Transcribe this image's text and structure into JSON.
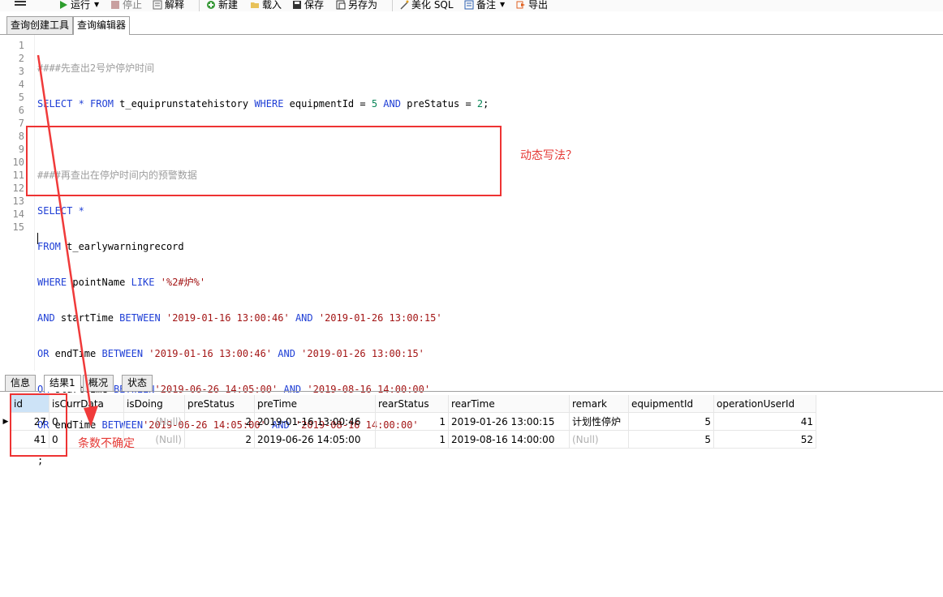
{
  "toolbar": {
    "run": "运行",
    "stop": "停止",
    "explain": "解释",
    "new": "新建",
    "load": "载入",
    "save": "保存",
    "save_as": "另存为",
    "beautify": "美化 SQL",
    "backup": "备注",
    "export": "导出"
  },
  "top_tabs": [
    "查询创建工具",
    "查询编辑器"
  ],
  "editor": {
    "line_numbers": [
      "1",
      "2",
      "3",
      "4",
      "5",
      "6",
      "7",
      "8",
      "9",
      "10",
      "11",
      "12",
      "13",
      "14",
      "15"
    ],
    "line1": "####先查出2号炉停炉时间",
    "line2_a": "SELECT * ",
    "line2_b": "FROM",
    "line2_c": " t_equiprunstatehistory ",
    "line2_d": "WHERE",
    "line2_e": " equipmentId = ",
    "line2_f": "5",
    "line2_g": "AND",
    "line2_h": " preStatus = ",
    "line2_i": "2",
    "line2_j": ";",
    "line4": "####再查出在停炉时间内的预警数据",
    "line5": "SELECT *",
    "line6_a": "FROM",
    "line6_b": " t_earlywarningrecord",
    "line7_a": "WHERE",
    "line7_b": " pointName ",
    "line7_c": "LIKE",
    "line7_d": "'%2#炉%'",
    "line8_a": "AND",
    "line8_b": " startTime ",
    "line8_c": "BETWEEN",
    "line8_d": "'2019-01-16 13:00:46'",
    "line8_e": "AND",
    "line8_f": "'2019-01-26 13:00:15'",
    "line9_a": "OR",
    "line9_b": " endTime ",
    "line9_c": "BETWEEN",
    "line9_d": "'2019-01-16 13:00:46'",
    "line9_e": "AND",
    "line9_f": "'2019-01-26 13:00:15'",
    "line10_a": "OR",
    "line10_b": " startTime ",
    "line10_c": "BETWEEN",
    "line10_d": "'2019-06-26 14:05:00'",
    "line10_e": "AND",
    "line10_f": "'2019-08-16 14:00:00'",
    "line11_a": "OR",
    "line11_b": " endTime ",
    "line11_c": "BETWEEN",
    "line11_d": "'2019-06-26 14:05:00'",
    "line11_e": "AND",
    "line11_f": "'2019-08-16 14:00:00'",
    "line12": ";"
  },
  "annotations": {
    "dynamic": "动态写法？",
    "count": "条数不确定"
  },
  "bottom_tabs": [
    "信息",
    "结果1",
    "概况",
    "状态"
  ],
  "result": {
    "columns": [
      "id",
      "isCurrData",
      "isDoing",
      "preStatus",
      "preTime",
      "rearStatus",
      "rearTime",
      "remark",
      "equipmentId",
      "operationUserId"
    ],
    "rows": [
      [
        "27",
        "0",
        "(Null)",
        "2",
        "2019-01-16 13:00:46",
        "1",
        "2019-01-26 13:00:15",
        "计划性停炉",
        "5",
        "41"
      ],
      [
        "41",
        "0",
        "(Null)",
        "2",
        "2019-06-26 14:05:00",
        "1",
        "2019-08-16 14:00:00",
        "(Null)",
        "5",
        "52"
      ]
    ]
  },
  "colors": {
    "keyword": "#1f3fd6",
    "string": "#a31515",
    "number": "#098658",
    "comment": "#9d9d9d",
    "annotation": "#e53935"
  }
}
